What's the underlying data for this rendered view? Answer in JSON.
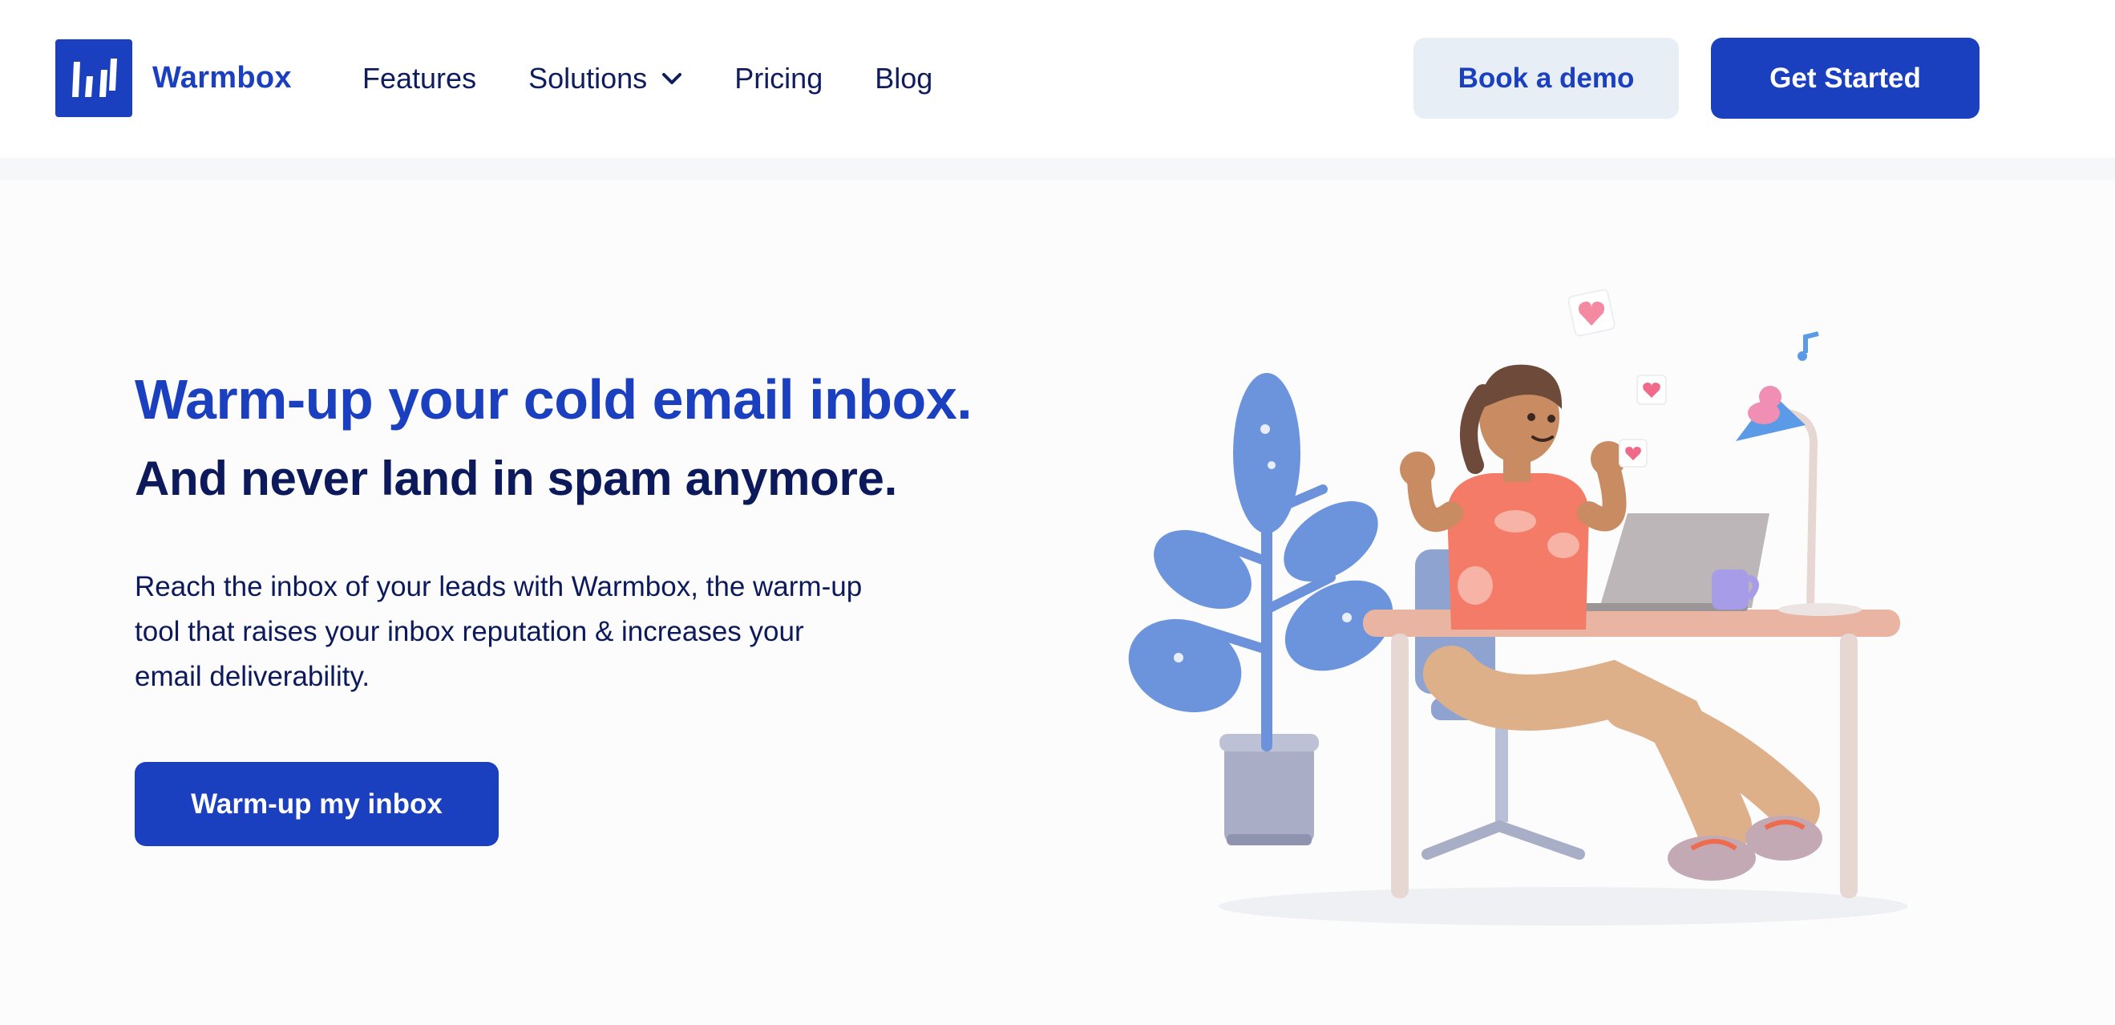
{
  "brand": {
    "name": "Warmbox",
    "logo_icon": "warmbox-logo-icon",
    "accent_color": "#1a3fbf",
    "dark_text_color": "#0c1a5c"
  },
  "nav": {
    "items": [
      {
        "label": "Features"
      },
      {
        "label": "Solutions",
        "icon": "chevron-down-icon"
      },
      {
        "label": "Pricing"
      },
      {
        "label": "Blog"
      }
    ]
  },
  "header": {
    "book_demo_label": "Book a demo",
    "get_started_label": "Get Started"
  },
  "hero": {
    "title": "Warm-up your cold email inbox.",
    "subtitle": "And never land in spam anymore.",
    "description": "Reach the inbox of your leads with Warmbox, the warm-up tool that raises your inbox reputation & increases your email deliverability.",
    "cta_label": "Warm-up my inbox",
    "illustration": "woman-at-desk-with-laptop-illustration"
  }
}
